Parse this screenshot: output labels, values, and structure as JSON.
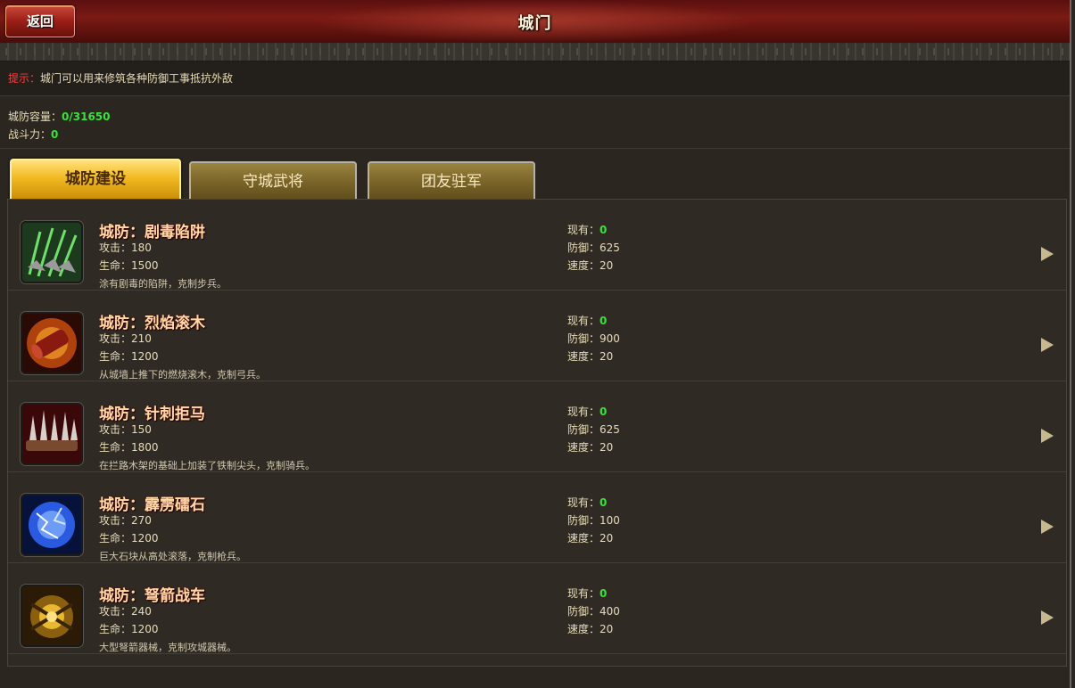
{
  "header": {
    "title": "城门",
    "back_label": "返回"
  },
  "tip": {
    "label": "提示：",
    "text": "城门可以用来修筑各种防御工事抵抗外敌"
  },
  "stats": {
    "capacity_label": "城防容量：",
    "capacity_value": "0/31650",
    "power_label": "战斗力：",
    "power_value": "0"
  },
  "tabs": [
    {
      "label": "城防建设",
      "active": true
    },
    {
      "label": "守城武将",
      "active": false
    },
    {
      "label": "团友驻军",
      "active": false
    }
  ],
  "labels": {
    "attack": "攻击：",
    "hp": "生命：",
    "owned": "现有：",
    "defense": "防御：",
    "speed": "速度："
  },
  "items": [
    {
      "name": "城防：剧毒陷阱",
      "attack": "180",
      "hp": "1500",
      "owned": "0",
      "defense": "625",
      "speed": "20",
      "desc": "涂有剧毒的陷阱，克制步兵。",
      "icon": "poison-trap-icon"
    },
    {
      "name": "城防：烈焰滚木",
      "attack": "210",
      "hp": "1200",
      "owned": "0",
      "defense": "900",
      "speed": "20",
      "desc": "从城墙上推下的燃烧滚木，克制弓兵。",
      "icon": "flaming-log-icon"
    },
    {
      "name": "城防：针刺拒马",
      "attack": "150",
      "hp": "1800",
      "owned": "0",
      "defense": "625",
      "speed": "20",
      "desc": "在拦路木架的基础上加装了铁制尖头，克制骑兵。",
      "icon": "spiked-barricade-icon"
    },
    {
      "name": "城防：霹雳礌石",
      "attack": "270",
      "hp": "1200",
      "owned": "0",
      "defense": "100",
      "speed": "20",
      "desc": "巨大石块从高处滚落，克制枪兵。",
      "icon": "thunder-boulder-icon"
    },
    {
      "name": "城防：弩箭战车",
      "attack": "240",
      "hp": "1200",
      "owned": "0",
      "defense": "400",
      "speed": "20",
      "desc": "大型弩箭器械，克制攻城器械。",
      "icon": "crossbow-chariot-icon"
    }
  ],
  "colors": {
    "accent_green": "#39e23a",
    "tip_red": "#ff3c3c",
    "name_gold": "#ffd9a6"
  }
}
